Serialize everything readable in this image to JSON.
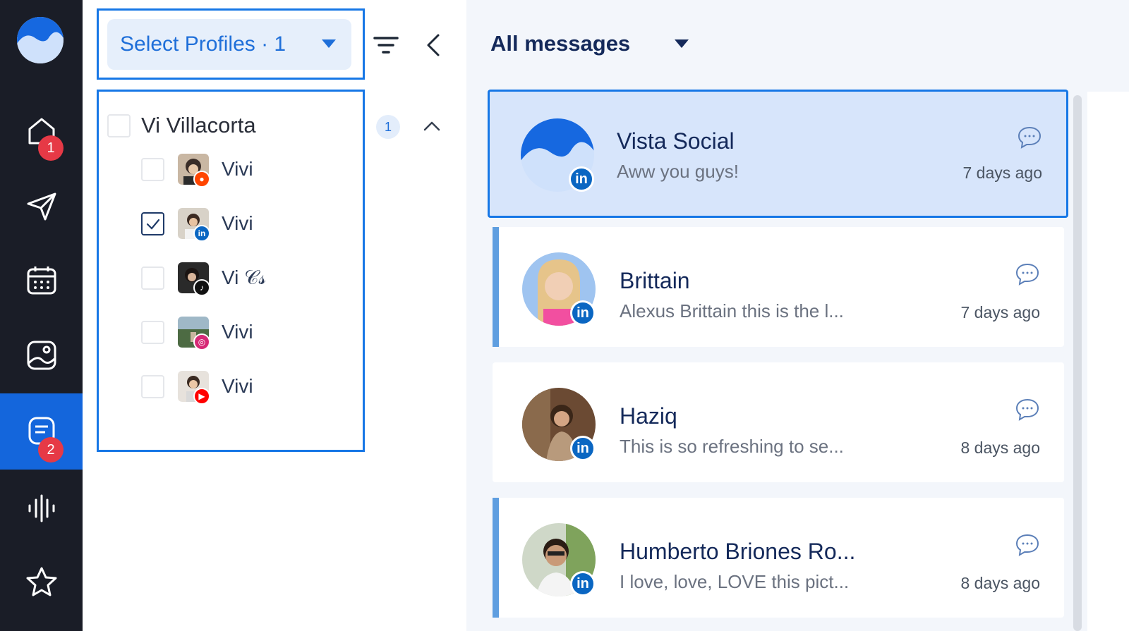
{
  "rail": {
    "home_badge": "1",
    "inbox_badge": "2",
    "items": [
      "home-icon",
      "send-icon",
      "calendar-icon",
      "media-icon",
      "inbox-icon",
      "listening-icon",
      "star-icon"
    ]
  },
  "profiles": {
    "select_label": "Select Profiles · 1",
    "group": {
      "name": "Vi Villacorta",
      "count": "1"
    },
    "items": [
      {
        "name": "Vivi",
        "network": "reddit",
        "checked": false
      },
      {
        "name": "Vivi",
        "network": "linkedin",
        "checked": true
      },
      {
        "name": "Vi 𝒞𝓈",
        "network": "tiktok",
        "checked": false
      },
      {
        "name": "Vivi",
        "network": "instagram",
        "checked": false
      },
      {
        "name": "Vivi",
        "network": "youtube",
        "checked": false
      }
    ]
  },
  "messages": {
    "header": "All messages",
    "items": [
      {
        "name": "Vista Social",
        "preview": "Aww you guys!",
        "time": "7 days ago",
        "selected": true
      },
      {
        "name": "Brittain",
        "preview": "Alexus Brittain this is the l...",
        "time": "7 days ago",
        "selected": false
      },
      {
        "name": "Haziq",
        "preview": "This is so refreshing to se...",
        "time": "8 days ago",
        "selected": false
      },
      {
        "name": "Humberto Briones Ro...",
        "preview": "I love, love, LOVE this pict...",
        "time": "8 days ago",
        "selected": false
      }
    ]
  },
  "colors": {
    "accent": "#1677e6",
    "rail_bg": "#1a1d27",
    "badge": "#e63946",
    "linkedin": "#0a66c2"
  }
}
